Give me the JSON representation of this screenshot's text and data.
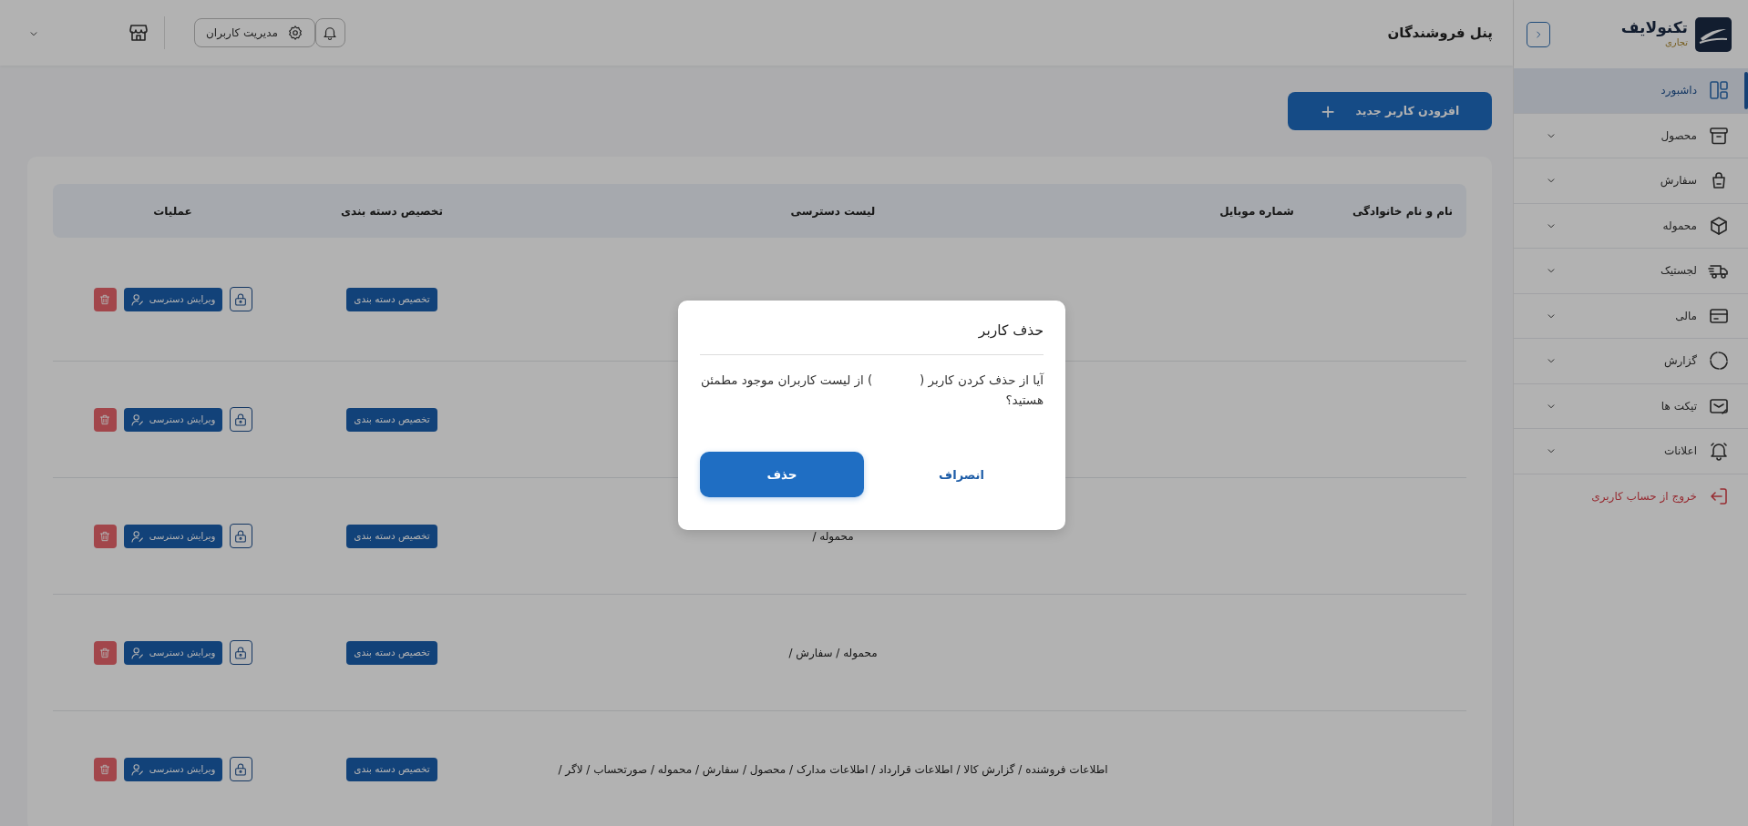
{
  "brand": {
    "name": "تکنولایف",
    "tagline": "تجاری"
  },
  "sidebar": {
    "items": [
      {
        "label": "داشبورد",
        "selected": true,
        "expandable": false,
        "kind": "link"
      },
      {
        "label": "محصول",
        "selected": false,
        "expandable": true,
        "kind": "link"
      },
      {
        "label": "سفارش",
        "selected": false,
        "expandable": true,
        "kind": "link"
      },
      {
        "label": "محموله",
        "selected": false,
        "expandable": true,
        "kind": "link"
      },
      {
        "label": "لجستیک",
        "selected": false,
        "expandable": true,
        "kind": "link"
      },
      {
        "label": "مالی",
        "selected": false,
        "expandable": true,
        "kind": "link"
      },
      {
        "label": "گزارش",
        "selected": false,
        "expandable": true,
        "kind": "link"
      },
      {
        "label": "تیکت ها",
        "selected": false,
        "expandable": true,
        "kind": "link"
      },
      {
        "label": "اعلانات",
        "selected": false,
        "expandable": true,
        "kind": "link"
      },
      {
        "label": "خروج از حساب کاربری",
        "selected": false,
        "expandable": false,
        "kind": "logout"
      }
    ]
  },
  "header": {
    "title": "پنل فروشندگان",
    "user_management": "مدیریت کاربران"
  },
  "add_button": {
    "label": "افزودن کاربر جدید",
    "icon_text": "+"
  },
  "table": {
    "columns": [
      "نام و نام خانوادگی",
      "شماره موبایل",
      "لیست دسترسی",
      "تخصیص دسته بندی",
      "عملیات"
    ],
    "rows": [
      {
        "category_button": "تخصیص دسته بندی",
        "edit_button": "ویرایش دسترسی"
      },
      {
        "category_button": "تخصیص دسته بندی",
        "edit_button": "ویرایش دسترسی"
      },
      {
        "access": "محموله /",
        "category_button": "تخصیص دسته بندی",
        "edit_button": "ویرایش دسترسی"
      },
      {
        "access": "محموله / سفارش /",
        "category_button": "تخصیص دسته بندی",
        "edit_button": "ویرایش دسترسی"
      },
      {
        "access": "اطلاعات فروشنده / گزارش کالا / اطلاعات قرارداد / اطلاعات مدارک / محصول / سفارش / محموله / صورتحساب / لاگر /",
        "category_button": "تخصیص دسته بندی",
        "edit_button": "ویرایش دسترسی"
      }
    ]
  },
  "modal": {
    "title": "حذف کاربر",
    "message": "آیا از حذف کردن کاربر (            ) از لیست کاربران موجود مطمئن هستید؟",
    "confirm": "حذف",
    "cancel": "انصراف"
  }
}
